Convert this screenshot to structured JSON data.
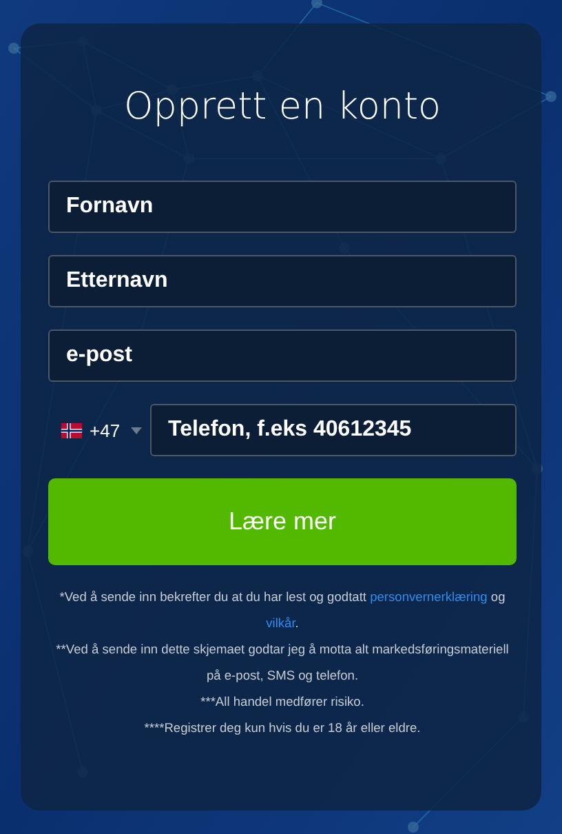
{
  "title": "Opprett en konto",
  "fields": [
    {
      "placeholder": "Fornavn"
    },
    {
      "placeholder": "Etternavn"
    },
    {
      "placeholder": "e-post"
    }
  ],
  "phone": {
    "country_code": "+47",
    "placeholder": "Telefon, f.eks 40612345"
  },
  "submit_button": "Lære mer",
  "consent": {
    "text": "*Ved å sende inn bekrefter du at du har lest og godtatt",
    "privacy_link": "personvernerklæring",
    "joiner": "og",
    "terms_link": "vilkår",
    "end": "."
  },
  "notes": [
    "**Ved å sende inn dette skjemaet godtar jeg å motta alt markedsføringsmateriell på e-post, SMS og telefon.",
    "***All handel medfører risiko.",
    "****Registrer deg kun hvis du er 18 år eller eldre."
  ]
}
